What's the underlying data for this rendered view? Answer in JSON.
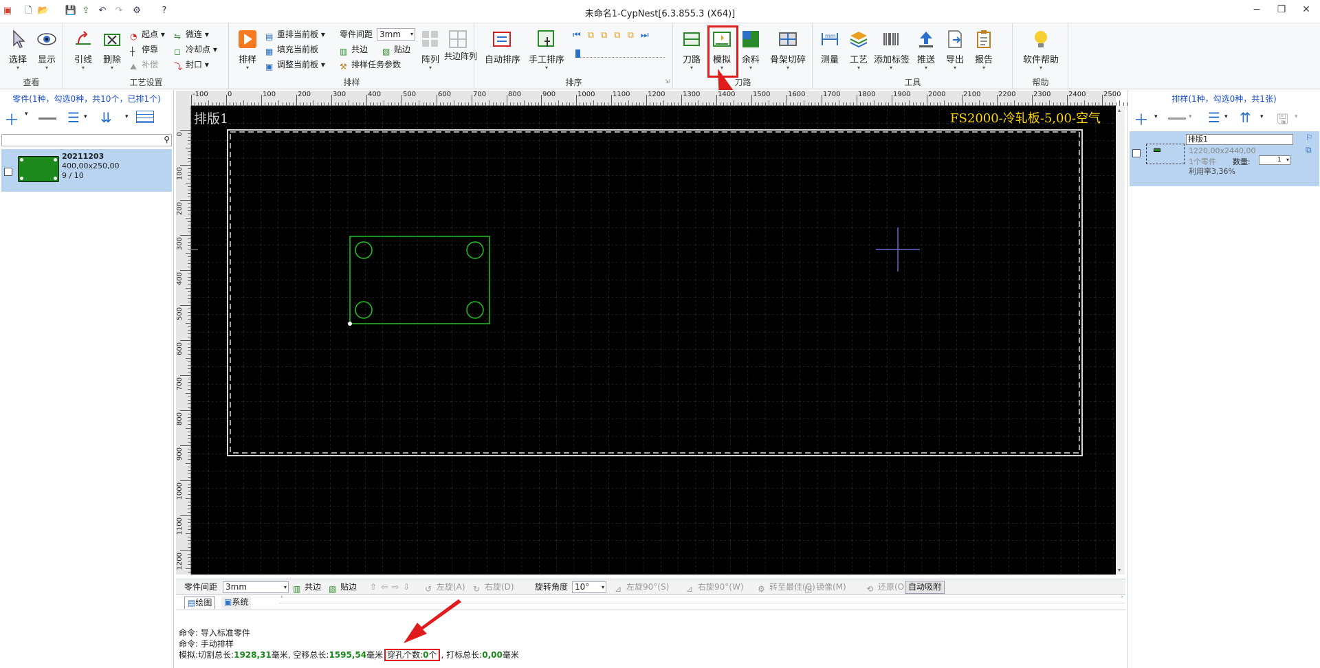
{
  "window": {
    "title": "未命名1-CypNest[6.3.855.3 (X64)]",
    "controls": {
      "minimize": "−",
      "restore": "❐",
      "close": "✕"
    }
  },
  "ribbon": {
    "groups": {
      "view": "查看",
      "process": "工艺设置",
      "nesting": "排样",
      "sorting": "排序",
      "toolpath": "刀路",
      "tools": "工具",
      "help": "帮助"
    },
    "view": {
      "select": "选择",
      "display": "显示"
    },
    "process": {
      "lead": "引线",
      "delete": "删除",
      "start_point": "起点",
      "stop_point": "停靠",
      "compensation": "补偿",
      "micro_joint": "微连",
      "cooling_point": "冷却点",
      "seal": "封口"
    },
    "nesting": {
      "nest": "排样",
      "renest": "重排当前板",
      "fill": "填充当前板",
      "adjust": "调整当前板",
      "spacing_label": "零件间距",
      "spacing_value": "3mm",
      "common_edge": "共边",
      "stick_edge": "贴边",
      "task_params": "排样任务参数",
      "array": "阵列",
      "common_array": "共边阵列"
    },
    "sorting": {
      "auto": "自动排序",
      "manual": "手工排序"
    },
    "toolpath": {
      "toolpath": "刀路",
      "simulate": "模拟",
      "remnant": "余料",
      "skeleton": "骨架切碎"
    },
    "tools": {
      "measure": "测量",
      "craft": "工艺",
      "add_label": "添加标签",
      "push": "推送",
      "export": "导出",
      "report": "报告"
    },
    "help": {
      "software_help": "软件帮助"
    }
  },
  "left_panel": {
    "title": "零件(1种，勾选0种，共10个，已排1个)",
    "search_placeholder": "",
    "parts": [
      {
        "name": "20211203",
        "size": "400,00x250,00",
        "count": "9 / 10"
      }
    ]
  },
  "right_panel": {
    "title": "排样(1种，勾选0种，共1张)",
    "sheets": [
      {
        "name": "排版1",
        "size": "1220,00x2440,00",
        "parts": "1个零件",
        "qty_label": "数量:",
        "qty": "1",
        "utilization": "利用率3,36%"
      }
    ]
  },
  "canvas": {
    "sheet_label": "排版1",
    "material_label": "FS2000-冷轧板-5,00-空气",
    "ruler_top": [
      "-100",
      "0",
      "100",
      "200",
      "300",
      "400",
      "500",
      "600",
      "700",
      "800",
      "900",
      "1000",
      "1100",
      "1200",
      "1300",
      "1400",
      "1500",
      "1600",
      "1700",
      "1800",
      "1900",
      "2000",
      "2100",
      "2200",
      "2300",
      "2400",
      "2500"
    ],
    "ruler_left": [
      "0",
      "100",
      "200",
      "300",
      "400",
      "500",
      "600",
      "700",
      "800",
      "900",
      "1000",
      "1100",
      "1200"
    ]
  },
  "bottom_toolbar": {
    "spacing_label": "零件间距",
    "spacing_value": "3mm",
    "common_edge": "共边",
    "stick_edge": "贴边",
    "rotate_left": "左旋(A)",
    "rotate_right": "右旋(D)",
    "angle_label": "旋转角度",
    "angle_value": "10°",
    "left90": "左旋90°(S)",
    "right90": "右旋90°(W)",
    "best": "转至最佳(Q)",
    "mirror": "镜像(M)",
    "restore": "还原(O)",
    "auto_snap": "自动吸附"
  },
  "tabs": {
    "drawing": "绘图",
    "system": "系统"
  },
  "command_log": {
    "line1": "命令: 导入标准零件",
    "line2": "命令: 手动排样",
    "sim_prefix": "模拟:切割总长:",
    "cut_len": "1928,31",
    "unit1": "毫米, 空移总长:",
    "move_len": "1595,54",
    "unit2": "毫米",
    "pierce_label": "穿孔个数:",
    "pierce_count": "0",
    "pierce_unit": "个",
    "mark_label": ", 打标总长:",
    "mark_len": "0,00",
    "unit3": "毫米"
  },
  "colors": {
    "highlight": "#e01b1b",
    "part_outline": "#22c422",
    "material_text": "#ffd700",
    "panel_select": "#b8d4f0",
    "title_blue": "#1a4fc9"
  }
}
